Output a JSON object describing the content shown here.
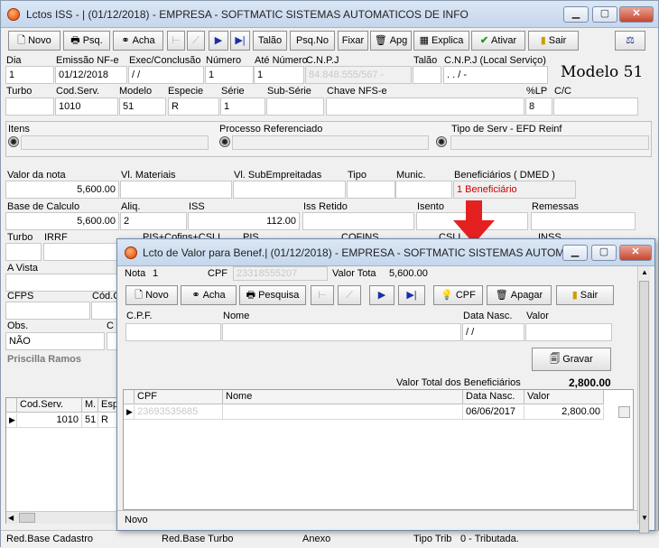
{
  "main": {
    "title": "Lctos ISS - | (01/12/2018) - EMPRESA - SOFTMATIC SISTEMAS AUTOMATICOS DE INFO",
    "toolbar": {
      "novo": "Novo",
      "pesq": "Psq.",
      "acha": "Acha",
      "talao": "Talão",
      "psqno": "Psq.No",
      "fixar": "Fixar",
      "apg": "Apg",
      "explica": "Explica",
      "ativar": "Ativar",
      "sair": "Sair"
    },
    "row1": {
      "labels": [
        "Dia",
        "Emissão NF-e",
        "Exec/Conclusão",
        "Número",
        "Até Número",
        "C.N.P.J",
        "Talão",
        "C.N.P.J (Local Serviço)"
      ],
      "dia": "1",
      "emissao": "01/12/2018",
      "exec": " / /",
      "numero": "1",
      "ate": "1",
      "cnpj": "84.848.555/567 -",
      "talao": "",
      "cnpj_local": ". . / -"
    },
    "modelo_title": "Modelo 51",
    "row2": {
      "labels": [
        "Turbo",
        "Cod.Serv.",
        "Modelo",
        "Especie",
        "Série",
        "Sub-Série",
        "Chave NFS-e",
        "%LP",
        "C/C"
      ],
      "turbo": "",
      "codserv": "1010",
      "modelo": "51",
      "especie": "R",
      "serie": "1",
      "subserie": "",
      "chave": "",
      "lp": "8",
      "cc": ""
    },
    "sections": {
      "itens": "Itens",
      "processo": "Processo Referenciado",
      "tiposerv": "Tipo de Serv - EFD Reinf"
    },
    "row3": {
      "labels": [
        "Valor da nota",
        "Vl. Materiais",
        "Vl. SubEmpreitadas",
        "Tipo",
        "Munic.",
        "Beneficiários ( DMED )"
      ],
      "valor": "5,600.00",
      "beneficiarios": "1 Beneficiário"
    },
    "row4": {
      "labels": [
        "Base de Calculo",
        "Aliq.",
        "ISS",
        "Iss Retido",
        "Isento",
        "Remessas"
      ],
      "base": "5,600.00",
      "aliq": "2",
      "iss": "112.00"
    },
    "row5": {
      "labels": [
        "Turbo",
        "IRRF",
        "PIS+Cofins+CSLL",
        "PIS",
        "COFINS",
        "CSLL",
        "INSS"
      ]
    },
    "avista": "A Vista",
    "cfps": {
      "label": "CFPS",
      "cod": "Cód.C"
    },
    "obs": {
      "label": "Obs.",
      "value": "NÃO",
      "c": "C"
    },
    "user": "Priscilla Ramos",
    "grid": {
      "headers": [
        "Cod.Serv.",
        "M.",
        "Esp"
      ],
      "row": [
        "1010",
        "51",
        "R"
      ]
    },
    "statusbar": {
      "red_cad": "Red.Base Cadastro",
      "red_turbo": "Red.Base Turbo",
      "anexo": "Anexo",
      "tipo": "Tipo Trib",
      "tipo_val": "0 - Tributada."
    }
  },
  "dialog": {
    "title": "Lcto de Valor para Benef.| (01/12/2018) - EMPRESA - SOFTMATIC SISTEMAS AUTOMA...",
    "nota_label": "Nota",
    "nota": "1",
    "cpf_label": "CPF",
    "cpf": "23318555207",
    "valor_total_label": "Valor Tota",
    "valor_total": "5,600.00",
    "toolbar": {
      "novo": "Novo",
      "acha": "Acha",
      "pesquisa": "Pesquisa",
      "cpf": "CPF",
      "apagar": "Apagar",
      "sair": "Sair"
    },
    "form_labels": [
      "C.P.F.",
      "Nome",
      "Data Nasc.",
      "Valor"
    ],
    "data_nasc": " / /",
    "gravar": "Gravar",
    "total_label": "Valor Total dos Beneficiários",
    "total_value": "2,800.00",
    "grid": {
      "headers": [
        "CPF",
        "Nome",
        "Data Nasc.",
        "Valor"
      ],
      "row": [
        "23693535685",
        "",
        "06/06/2017",
        "2,800.00"
      ]
    },
    "status": "Novo"
  },
  "colors": {
    "accent_red": "#cc0000",
    "title_bg": "#c5d6ec",
    "arrow": "#e52020"
  }
}
